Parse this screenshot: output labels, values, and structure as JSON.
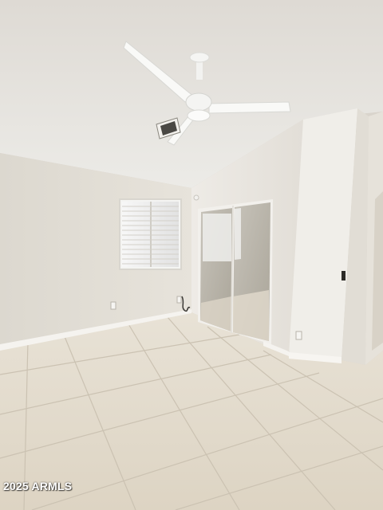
{
  "watermark": {
    "text": "2025 ARMLS"
  },
  "colors": {
    "ceiling": "#e9e6e1",
    "wall_left": "#e4e0d8",
    "wall_right": "#ebe8e2",
    "floor": "#e2dacb",
    "grout": "#c9bfae",
    "baseboard": "#f4f2ee",
    "fan": "#f7f7f5",
    "mirror": "#b9b5ab"
  },
  "icons": [
    "ceiling-fan-icon",
    "air-vent-icon",
    "power-outlet-icon",
    "window-blinds-icon"
  ]
}
